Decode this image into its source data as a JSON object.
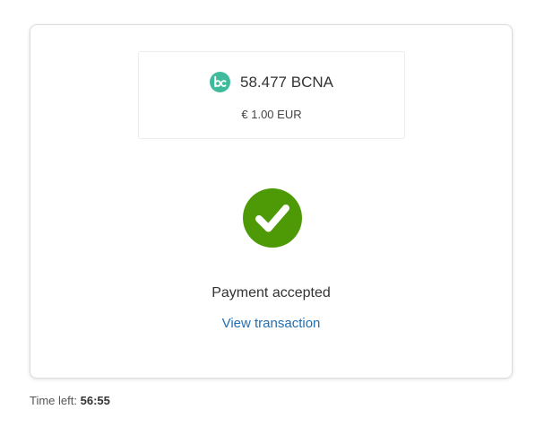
{
  "payment": {
    "coin_icon": "bcna-coin-icon",
    "amount_crypto": "58.477 BCNA",
    "amount_fiat": "€ 1.00 EUR",
    "status_icon": "check-circle-icon",
    "status_text": "Payment accepted",
    "link_text": "View transaction"
  },
  "timer": {
    "label": "Time left:",
    "value": "56:55"
  },
  "colors": {
    "coin": "#3dbb9b",
    "success": "#4e9a06",
    "link": "#1f6fb2"
  }
}
